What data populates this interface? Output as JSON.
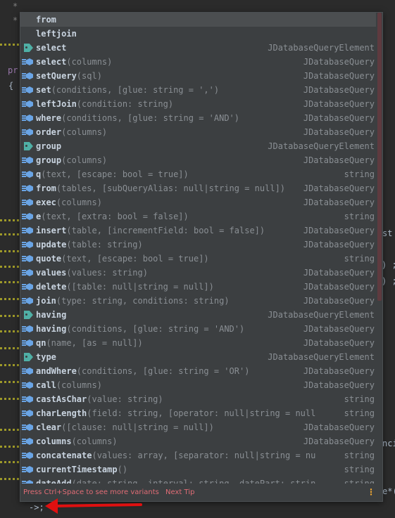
{
  "editor": {
    "fragments": [
      {
        "text": "*",
        "cls": "f1"
      },
      {
        "text": "*",
        "cls": "f2"
      },
      {
        "text": "pr",
        "cls": "f3"
      },
      {
        "text": "{",
        "cls": "f4"
      },
      {
        "text": "st",
        "cls": "f5"
      },
      {
        "text": ") ;",
        "cls": "f6"
      },
      {
        "text": ") ;",
        "cls": "f7"
      },
      {
        "text": "nci",
        "cls": "f8"
      },
      {
        "text": "e*(",
        "cls": "f9"
      }
    ],
    "typed_text": "->;"
  },
  "completion": {
    "items": [
      {
        "icon": "none",
        "name": "from",
        "params": "",
        "type": "",
        "selected": true
      },
      {
        "icon": "none",
        "name": "leftjoin",
        "params": "",
        "type": ""
      },
      {
        "icon": "tag",
        "name": "select",
        "params": "",
        "type": "JDatabaseQueryElement"
      },
      {
        "icon": "method",
        "name": "select",
        "params": "(columns)",
        "type": "JDatabaseQuery"
      },
      {
        "icon": "method",
        "name": "setQuery",
        "params": "(sql)",
        "type": "JDatabaseQuery"
      },
      {
        "icon": "method",
        "name": "set",
        "params": "(conditions, [glue: string = ',')",
        "type": "JDatabaseQuery"
      },
      {
        "icon": "method",
        "name": "leftJoin",
        "params": "(condition: string)",
        "type": "JDatabaseQuery"
      },
      {
        "icon": "method",
        "name": "where",
        "params": "(conditions, [glue: string = 'AND')",
        "type": "JDatabaseQuery"
      },
      {
        "icon": "method",
        "name": "order",
        "params": "(columns)",
        "type": "JDatabaseQuery"
      },
      {
        "icon": "tag",
        "name": "group",
        "params": "",
        "type": "JDatabaseQueryElement"
      },
      {
        "icon": "method",
        "name": "group",
        "params": "(columns)",
        "type": "JDatabaseQuery"
      },
      {
        "icon": "method",
        "name": "q",
        "params": "(text, [escape: bool = true])",
        "type": "string"
      },
      {
        "icon": "method",
        "name": "from",
        "params": "(tables, [subQueryAlias: null|string = null])",
        "type": "JDatabaseQuery"
      },
      {
        "icon": "method",
        "name": "exec",
        "params": "(columns)",
        "type": "JDatabaseQuery"
      },
      {
        "icon": "method",
        "name": "e",
        "params": "(text, [extra: bool = false])",
        "type": "string"
      },
      {
        "icon": "method",
        "name": "insert",
        "params": "(table, [incrementField: bool = false])",
        "type": "JDatabaseQuery"
      },
      {
        "icon": "method",
        "name": "update",
        "params": "(table: string)",
        "type": "JDatabaseQuery"
      },
      {
        "icon": "method",
        "name": "quote",
        "params": "(text, [escape: bool = true])",
        "type": "string"
      },
      {
        "icon": "method",
        "name": "values",
        "params": "(values: string)",
        "type": "JDatabaseQuery"
      },
      {
        "icon": "method",
        "name": "delete",
        "params": "([table: null|string = null])",
        "type": "JDatabaseQuery"
      },
      {
        "icon": "method",
        "name": "join",
        "params": "(type: string, conditions: string)",
        "type": "JDatabaseQuery"
      },
      {
        "icon": "tag",
        "name": "having",
        "params": "",
        "type": "JDatabaseQueryElement"
      },
      {
        "icon": "method",
        "name": "having",
        "params": "(conditions, [glue: string = 'AND')",
        "type": "JDatabaseQuery"
      },
      {
        "icon": "method",
        "name": "qn",
        "params": "(name, [as = null])",
        "type": "JDatabaseQuery"
      },
      {
        "icon": "tag",
        "name": "type",
        "params": "",
        "type": "JDatabaseQueryElement"
      },
      {
        "icon": "method",
        "name": "andWhere",
        "params": "(conditions, [glue: string = 'OR')",
        "type": "JDatabaseQuery"
      },
      {
        "icon": "method",
        "name": "call",
        "params": "(columns)",
        "type": "JDatabaseQuery"
      },
      {
        "icon": "method",
        "name": "castAsChar",
        "params": "(value: string)",
        "type": "string"
      },
      {
        "icon": "method",
        "name": "charLength",
        "params": "(field: string, [operator: null|string = null], …",
        "type": "string"
      },
      {
        "icon": "method",
        "name": "clear",
        "params": "([clause: null|string = null])",
        "type": "JDatabaseQuery"
      },
      {
        "icon": "method",
        "name": "columns",
        "params": "(columns)",
        "type": "JDatabaseQuery"
      },
      {
        "icon": "method",
        "name": "concatenate",
        "params": "(values: array, [separator: null|string = null])",
        "type": "string"
      },
      {
        "icon": "method",
        "name": "currentTimestamp",
        "params": "()",
        "type": "string"
      },
      {
        "icon": "method",
        "name": "dateAdd",
        "params": "(date: string, interval: string, datePart: string)",
        "type": "string"
      }
    ],
    "footer_text": "Press Ctrl+Space to see more variants",
    "footer_tip": "Next Tip",
    "footer_more": "⋮"
  },
  "colors": {
    "popup_bg": "#3c3f41",
    "selected_row": "#4b4e50",
    "method_icon": "#6aa5e6",
    "tag_icon": "#4fb0a6",
    "footer_text": "#e06c75",
    "arrow": "#e01010"
  }
}
